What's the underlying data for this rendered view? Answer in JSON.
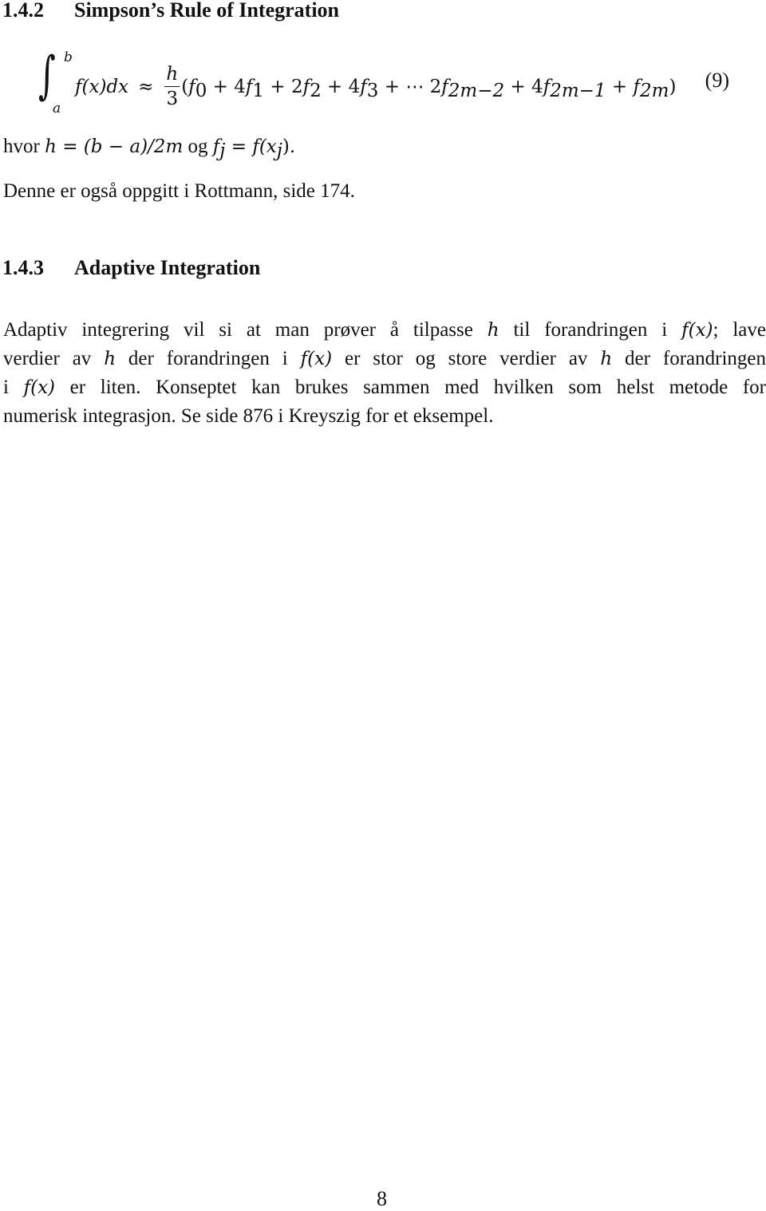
{
  "section_1": {
    "number": "1.4.2",
    "title": "Simpson’s Rule of Integration"
  },
  "equation": {
    "integral_upper": "b",
    "integral_lower": "a",
    "integrand": "f(x)dx",
    "approx": "≈",
    "frac_num": "h",
    "frac_den": "3",
    "terms": [
      {
        "coef": "(",
        "f": "f",
        "sub": "0"
      },
      {
        "coef": " + 4",
        "f": "f",
        "sub": "1"
      },
      {
        "coef": " + 2",
        "f": "f",
        "sub": "2"
      },
      {
        "coef": " + 4",
        "f": "f",
        "sub": "3"
      },
      {
        "coef": " + ⋯ 2",
        "f": "f",
        "sub": "2m−2"
      },
      {
        "coef": " + 4",
        "f": "f",
        "sub": "2m−1"
      },
      {
        "coef": " + ",
        "f": "f",
        "sub": "2m"
      }
    ],
    "close": ")",
    "number": "(9)"
  },
  "where_line": {
    "prefix": "hvor ",
    "h_def": "h = (b − a)/2m",
    "og": " og ",
    "f_j": "f",
    "f_j_sub": "j",
    "f_j_rest": " = f(x",
    "x_sub": "j",
    "end": ")."
  },
  "ref_line": "Denne er også oppgitt i Rottmann, side 174.",
  "section_2": {
    "number": "1.4.3",
    "title": "Adaptive Integration"
  },
  "paragraph": {
    "line1": [
      "Adaptiv integrering vil si at man prøver å tilpasse ",
      "h",
      " til forandringen i ",
      "f(x)",
      "; lave"
    ],
    "line2": [
      "verdier av ",
      "h",
      " der forandringen i ",
      "f(x)",
      " er stor og store verdier av ",
      "h",
      " der forandringen"
    ],
    "line3": [
      "i ",
      "f(x)",
      " er liten. Konseptet kan brukes sammen med hvilken som helst metode for"
    ],
    "line4": "numerisk integrasjon. Se side 876 i Kreyszig for et eksempel."
  },
  "page_number": "8"
}
